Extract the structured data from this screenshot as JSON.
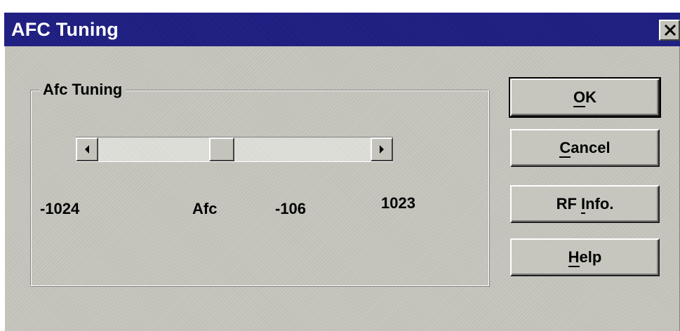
{
  "window": {
    "title": "AFC Tuning",
    "close_icon": "close-icon"
  },
  "group": {
    "label": "Afc Tuning"
  },
  "slider": {
    "min_label": "-1024",
    "max_label": "1023",
    "name_label": "Afc",
    "value_label": "-106",
    "value": -106,
    "min": -1024,
    "max": 1023,
    "left_arrow_icon": "left-arrow-icon",
    "right_arrow_icon": "right-arrow-icon"
  },
  "buttons": {
    "ok": "OK",
    "cancel": "Cancel",
    "rf_info": "RF Info.",
    "help": "Help"
  },
  "colors": {
    "face": "#c4c4bc",
    "titlebar": "#1c1c80",
    "title_text": "#ffffff"
  }
}
